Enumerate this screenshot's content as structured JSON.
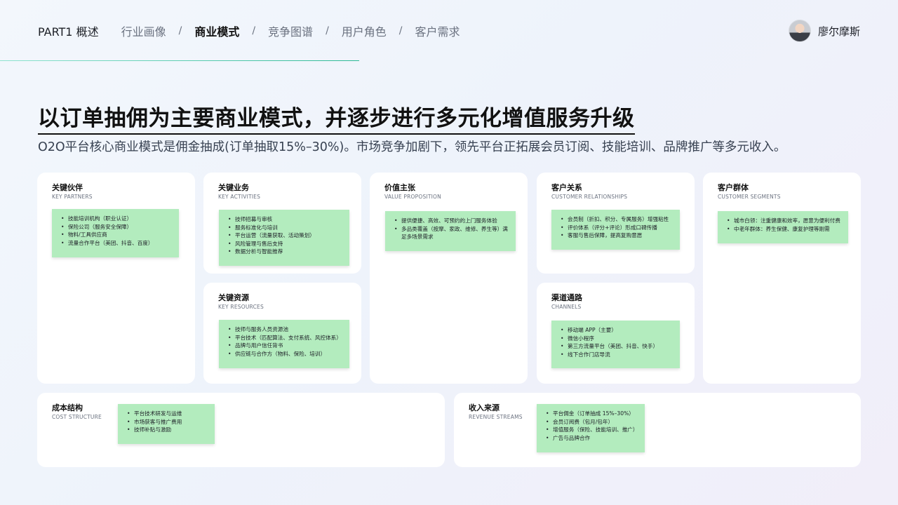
{
  "nav": {
    "part": "PART1 概述",
    "items": [
      "行业画像",
      "商业模式",
      "竞争图谱",
      "用户角色",
      "客户需求"
    ],
    "active_index": 1,
    "separator": "/"
  },
  "user": {
    "name": "廖尔摩斯"
  },
  "title": "以订单抽佣为主要商业模式，并逐步进行多元化增值服务升级",
  "subtitle": "O2O平台核心商业模式是佣金抽成(订单抽取15%–30%)。市场竞争加剧下，领先平台正拓展会员订阅、技能培训、品牌推广等多元收入。",
  "canvas": {
    "key_partners": {
      "title": "关键伙伴",
      "subtitle": "KEY PARTNERS",
      "items": [
        "技能培训机构（职业认证）",
        "保险公司（服务安全保障）",
        "物料/工具供应商",
        "流量合作平台（美团、抖音、百度）"
      ]
    },
    "key_activities": {
      "title": "关键业务",
      "subtitle": "KEY ACTIVITIES",
      "items": [
        "技师招募与审核",
        "服务标准化与培训",
        "平台运营（流量获取、活动策划）",
        "风险管理与售后支持",
        "数据分析与智能推荐"
      ]
    },
    "key_resources": {
      "title": "关键资源",
      "subtitle": "KEY RESOURCES",
      "items": [
        "技师与服务人员资源池",
        "平台技术（匹配算法、支付系统、风控体系）",
        "品牌与用户信任背书",
        "供应链与合作方（物料、保险、培训）"
      ]
    },
    "value_proposition": {
      "title": "价值主张",
      "subtitle": "VALUE PROPOSITION",
      "items": [
        "提供便捷、高效、可预约的上门服务体验",
        "多品类覆盖（按摩、家政、维修、养生等）满足多场景需求"
      ]
    },
    "customer_relationships": {
      "title": "客户关系",
      "subtitle": "CUSTOMER RELATIONSHIPS",
      "items": [
        "会员制（折扣、积分、专属服务）增强粘性",
        "评价体系（评分+评论）形成口碑传播",
        "客服与售后保障，提高复购意愿"
      ]
    },
    "channels": {
      "title": "渠道通路",
      "subtitle": "CHANNELS",
      "items": [
        "移动端 APP（主要）",
        "微信小程序",
        "第三方流量平台（美团、抖音、快手）",
        "线下合作门店导流"
      ]
    },
    "customer_segments": {
      "title": "客户群体",
      "subtitle": "CUSTOMER SEGMENTS",
      "items": [
        "城市白领：注重健康和效率，愿意为便利付费",
        "中老年群体：养生保健、康复护理等刚需"
      ]
    },
    "cost_structure": {
      "title": "成本结构",
      "subtitle": "COST STRUCTURE",
      "items": [
        "平台技术研发与运维",
        "市场获客与推广费用",
        "技师补贴与激励"
      ]
    },
    "revenue_streams": {
      "title": "收入来源",
      "subtitle": "REVENUE STREAMS",
      "items": [
        "平台佣金（订单抽成 15%–30%）",
        "会员订阅费（包月/包年）",
        "增值服务（保险、技能培训、推广）",
        "广告与品牌合作"
      ]
    }
  },
  "colors": {
    "note": "#b3ecbe",
    "accent_line": "#2bb894"
  }
}
